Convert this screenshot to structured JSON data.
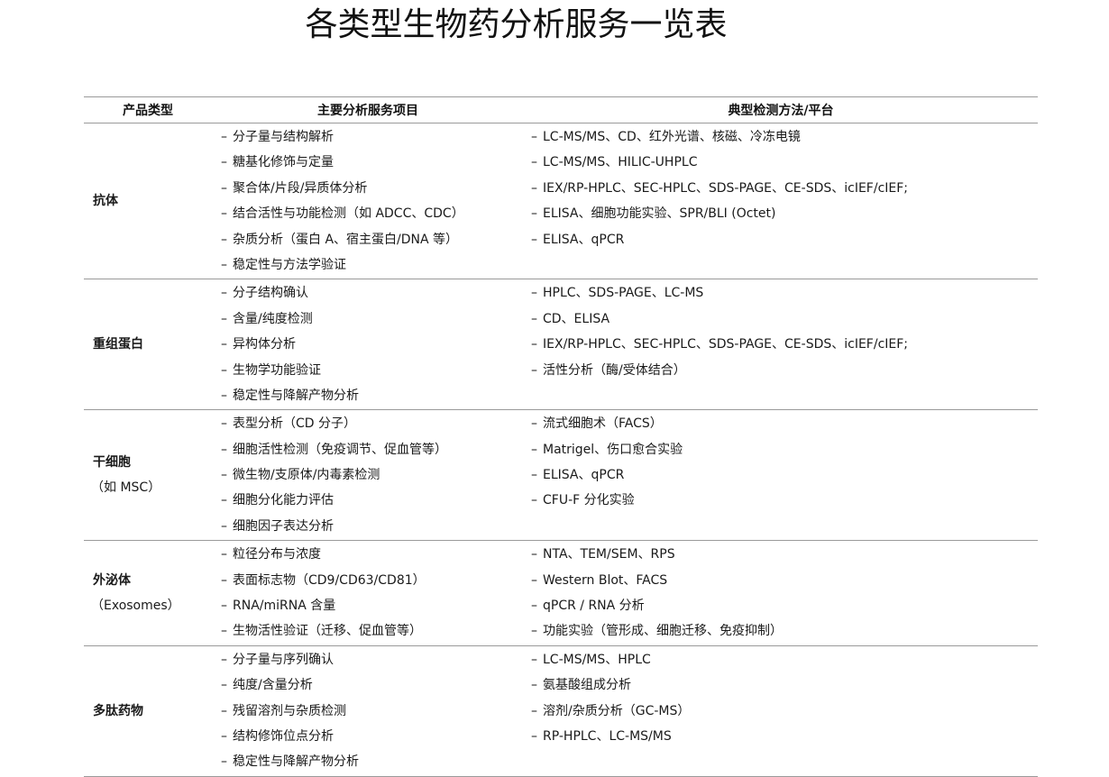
{
  "title": "各类型生物药分析服务一览表",
  "table": {
    "headers": [
      "产品类型",
      "主要分析服务项目",
      "典型检测方法/平台"
    ],
    "rows": [
      {
        "category": "抗体",
        "category_sub": "",
        "services": [
          "分子量与结构解析",
          "糖基化修饰与定量",
          "聚合体/片段/异质体分析",
          "结合活性与功能检测（如 ADCC、CDC）",
          "杂质分析（蛋白 A、宿主蛋白/DNA 等）",
          "稳定性与方法学验证"
        ],
        "methods": [
          "LC-MS/MS、CD、红外光谱、核磁、冷冻电镜",
          "LC-MS/MS、HILIC-UHPLC",
          "IEX/RP-HPLC、SEC-HPLC、SDS-PAGE、CE-SDS、icIEF/cIEF;",
          "ELISA、细胞功能实验、SPR/BLI (Octet)",
          "ELISA、qPCR"
        ]
      },
      {
        "category": "重组蛋白",
        "category_sub": "",
        "services": [
          "分子结构确认",
          "含量/纯度检测",
          "异构体分析",
          "生物学功能验证",
          "稳定性与降解产物分析"
        ],
        "methods": [
          "HPLC、SDS-PAGE、LC-MS",
          "CD、ELISA",
          "IEX/RP-HPLC、SEC-HPLC、SDS-PAGE、CE-SDS、icIEF/cIEF;",
          "活性分析（酶/受体结合）"
        ]
      },
      {
        "category": "干细胞",
        "category_sub": "（如 MSC）",
        "services": [
          "表型分析（CD 分子）",
          "细胞活性检测（免疫调节、促血管等）",
          "微生物/支原体/内毒素检测",
          "细胞分化能力评估",
          "细胞因子表达分析"
        ],
        "methods": [
          "流式细胞术（FACS）",
          "Matrigel、伤口愈合实验",
          "ELISA、qPCR",
          "CFU-F 分化实验"
        ]
      },
      {
        "category": "外泌体",
        "category_sub": "（Exosomes）",
        "services": [
          "粒径分布与浓度",
          "表面标志物（CD9/CD63/CD81）",
          "RNA/miRNA 含量",
          "生物活性验证（迁移、促血管等）"
        ],
        "methods": [
          "NTA、TEM/SEM、RPS",
          "Western Blot、FACS",
          "qPCR / RNA 分析",
          "功能实验（管形成、细胞迁移、免疫抑制）"
        ]
      },
      {
        "category": "多肽药物",
        "category_sub": "",
        "services": [
          "分子量与序列确认",
          "纯度/含量分析",
          "残留溶剂与杂质检测",
          "结构修饰位点分析",
          "稳定性与降解产物分析"
        ],
        "methods": [
          "LC-MS/MS、HPLC",
          "氨基酸组成分析",
          "溶剂/杂质分析（GC-MS）",
          "RP-HPLC、LC-MS/MS"
        ]
      }
    ]
  }
}
